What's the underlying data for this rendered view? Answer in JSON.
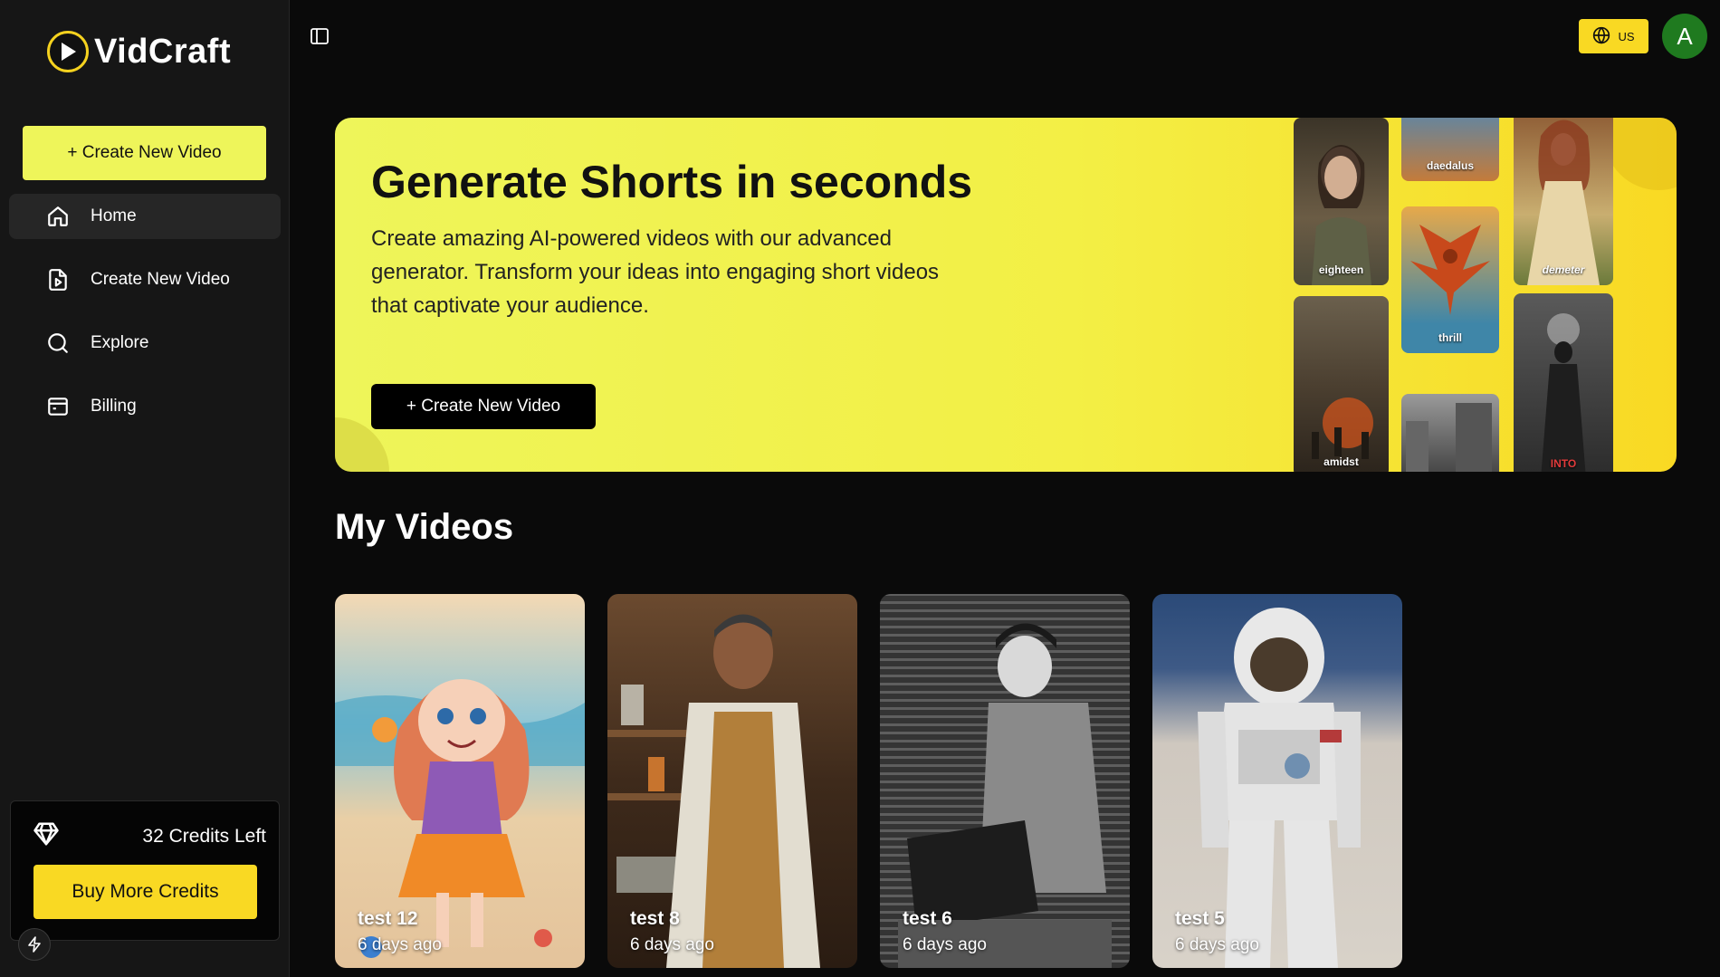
{
  "app": {
    "name": "VidCraft"
  },
  "sidebar": {
    "create_button": "+ Create New Video",
    "items": [
      {
        "label": "Home",
        "icon": "home-icon",
        "active": true
      },
      {
        "label": "Create New Video",
        "icon": "file-video-icon",
        "active": false
      },
      {
        "label": "Explore",
        "icon": "search-icon",
        "active": false
      },
      {
        "label": "Billing",
        "icon": "wallet-icon",
        "active": false
      }
    ],
    "credits_text": "32 Credits Left",
    "buy_button": "Buy More Credits"
  },
  "header": {
    "language": "US",
    "avatar_initial": "A"
  },
  "hero": {
    "title": "Generate Shorts in seconds",
    "description": "Create amazing AI-powered videos with our advanced generator. Transform your ideas into engaging short videos that captivate your audience.",
    "button": "+ Create New Video",
    "thumbnails": [
      "eighteen",
      "daedalus",
      "demeter",
      "thrill",
      "amidst",
      "INTO",
      ""
    ]
  },
  "my_videos": {
    "title": "My Videos",
    "items": [
      {
        "name": "test 12",
        "date": "6 days ago"
      },
      {
        "name": "test 8",
        "date": "6 days ago"
      },
      {
        "name": "test 6",
        "date": "6 days ago"
      },
      {
        "name": "test 5",
        "date": "6 days ago"
      }
    ]
  },
  "colors": {
    "accent_yellow": "#f9d923",
    "accent_lime": "#eef55a",
    "avatar_green": "#1f7a1f",
    "background": "#0a0a0a",
    "sidebar": "#161616"
  }
}
